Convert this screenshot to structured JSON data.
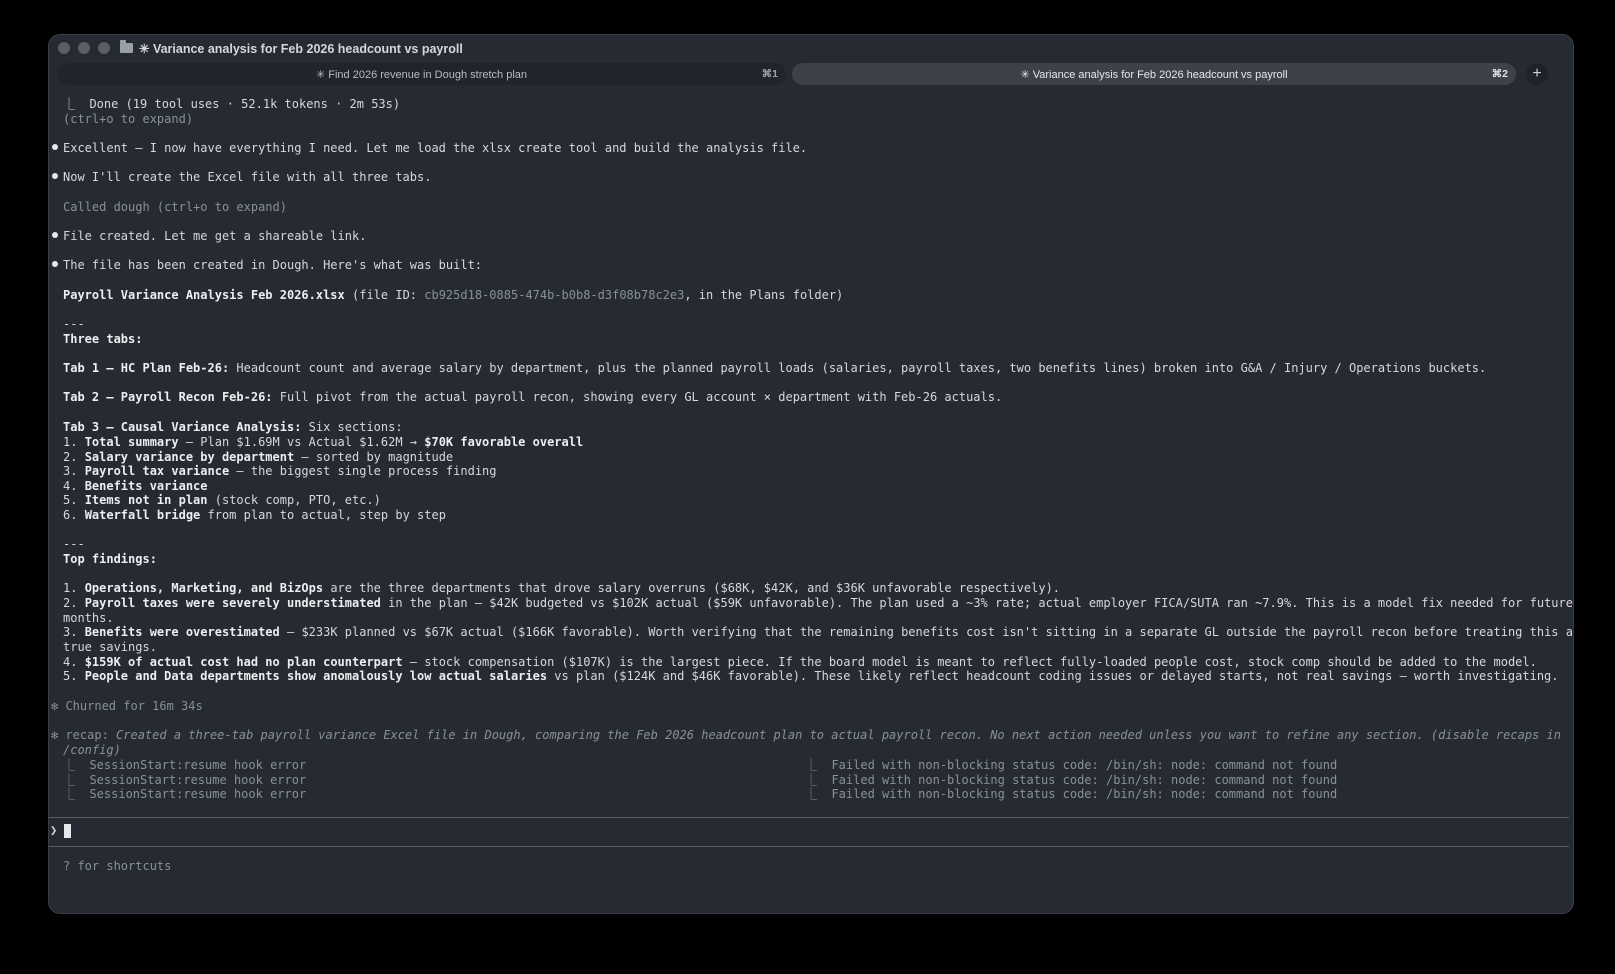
{
  "window": {
    "title": "✳ Variance analysis for Feb 2026 headcount vs payroll"
  },
  "tabs": [
    {
      "label": "✳ Find 2026 revenue in Dough stretch plan",
      "shortcut": "⌘1"
    },
    {
      "label": "✳ Variance analysis for Feb 2026 headcount vs payroll",
      "shortcut": "⌘2"
    }
  ],
  "new_tab_label": "+",
  "terminal": {
    "done_line": "⎿  Done (19 tool uses · 52.1k tokens · 2m 53s)",
    "expand_hint": "(ctrl+o to expand)",
    "msg1": "Excellent — I now have everything I need. Let me load the xlsx create tool and build the analysis file.",
    "msg2": "Now I'll create the Excel file with all three tabs.",
    "called": "Called dough (ctrl+o to expand)",
    "msg3": "File created. Let me get a shareable link.",
    "msg4": "The file has been created in Dough. Here's what was built:",
    "file_name": "Payroll Variance Analysis Feb 2026.xlsx",
    "file_pre": " (file ID: ",
    "file_id": "cb925d18-0885-474b-b0b8-d3f08b78c2e3",
    "file_post": ", in the Plans folder)",
    "rule1": "---",
    "three_tabs": "Three tabs:",
    "tab1_name": "Tab 1 — HC Plan Feb-26:",
    "tab1_desc": " Headcount count and average salary by department, plus the planned payroll loads (salaries, payroll taxes, two benefits lines) broken into G&A / Injury / Operations buckets.",
    "tab2_name": "Tab 2 — Payroll Recon Feb-26:",
    "tab2_desc": " Full pivot from the actual payroll recon, showing every GL account × department with Feb-26 actuals.",
    "tab3_name": "Tab 3 — Causal Variance Analysis:",
    "tab3_desc": " Six sections:",
    "s1_num": "1. ",
    "s1_bold": "Total summary",
    "s1_mid": " — Plan $1.69M vs Actual $1.62M → ",
    "s1_bold2": "$70K favorable overall",
    "s2_num": "2. ",
    "s2_bold": "Salary variance by department",
    "s2_rest": " — sorted by magnitude",
    "s3_num": "3. ",
    "s3_bold": "Payroll tax variance",
    "s3_rest": " — the biggest single process finding",
    "s4_num": "4. ",
    "s4_bold": "Benefits variance",
    "s5_num": "5. ",
    "s5_bold": "Items not in plan",
    "s5_rest": " (stock comp, PTO, etc.)",
    "s6_num": "6. ",
    "s6_bold": "Waterfall bridge",
    "s6_rest": " from plan to actual, step by step",
    "rule2": "---",
    "top_findings": "Top findings:",
    "f1_num": "1. ",
    "f1_bold": "Operations, Marketing, and BizOps",
    "f1_rest": " are the three departments that drove salary overruns ($68K, $42K, and $36K unfavorable respectively).",
    "f2_num": "2. ",
    "f2_bold": "Payroll taxes were severely understimated",
    "f2_rest": " in the plan — $42K budgeted vs $102K actual ($59K unfavorable). The plan used a ~3% rate; actual employer FICA/SUTA ran ~7.9%. This is a model fix needed for future",
    "f2_cont": "months.",
    "f3_num": "3. ",
    "f3_bold": "Benefits were overestimated",
    "f3_rest": " — $233K planned vs $67K actual ($166K favorable). Worth verifying that the remaining benefits cost isn't sitting in a separate GL outside the payroll recon before treating this as",
    "f3_cont": "true savings.",
    "f4_num": "4. ",
    "f4_bold": "$159K of actual cost had no plan counterpart",
    "f4_rest": " — stock compensation ($107K) is the largest piece. If the board model is meant to reflect fully-loaded people cost, stock comp should be added to the model.",
    "f5_num": "5. ",
    "f5_bold": "People and Data departments show anomalously low actual salaries",
    "f5_rest": " vs plan ($124K and $46K favorable). These likely reflect headcount coding issues or delayed starts, not real savings — worth investigating.",
    "churned": "✻ Churned for 16m 34s",
    "recap_label": "✻ recap:",
    "recap_text": " Created a three-tab payroll variance Excel file in Dough, comparing the Feb 2026 headcount plan to actual payroll recon. No next action needed unless you want to refine any section. (disable recaps in",
    "recap_cont": "/config)",
    "hook_errors": [
      "⎿  SessionStart:resume hook error",
      "⎿  SessionStart:resume hook error",
      "⎿  SessionStart:resume hook error"
    ],
    "hook_failures": [
      "⎿  Failed with non-blocking status code: /bin/sh: node: command not found",
      "⎿  Failed with non-blocking status code: /bin/sh: node: command not found",
      "⎿  Failed with non-blocking status code: /bin/sh: node: command not found"
    ],
    "prompt_symbol": "❯",
    "shortcuts_hint": "? for shortcuts"
  }
}
